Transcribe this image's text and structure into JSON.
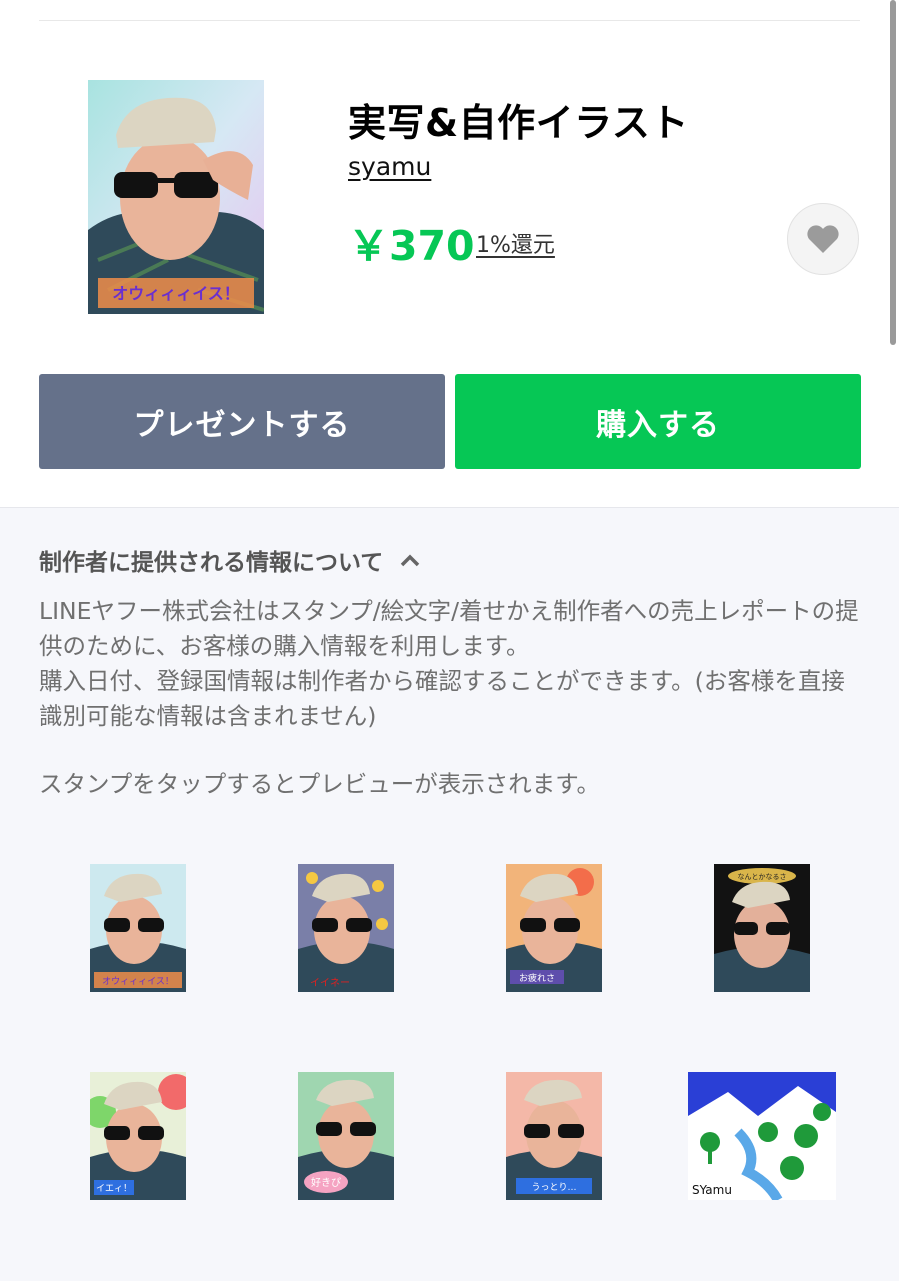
{
  "product": {
    "title": "実写&自作イラスト",
    "creator": "syamu",
    "price": "￥370",
    "cashback": "1%還元",
    "thumbnail_caption": "オウィィィイス！"
  },
  "actions": {
    "gift_label": "プレゼントする",
    "buy_label": "購入する"
  },
  "info": {
    "heading": "制作者に提供される情報について",
    "paragraph1": "LINEヤフー株式会社はスタンプ/絵文字/着せかえ制作者への売上レポートの提供のために、お客様の購入情報を利用します。",
    "paragraph2": "購入日付、登録国情報は制作者から確認することができます。(お客様を直接識別可能な情報は含まれません)",
    "preview_note": "スタンプをタップするとプレビューが表示されます。"
  },
  "stickers": {
    "s1_caption": "オウィィィイス！",
    "s2_caption": "イイネー",
    "s3_caption": "お疲れさ",
    "s4_caption": "なんとかなるさ",
    "s5_caption": "イエィ！",
    "s6_caption": "好きぴ",
    "s7_caption": "うっとり…",
    "s8_caption": "SYamu"
  },
  "icons": {
    "favorite": "heart-icon",
    "collapse": "chevron-up-icon"
  },
  "colors": {
    "accent_green": "#06c755",
    "gift_button": "#65718a",
    "info_background": "#f6f7fb"
  }
}
